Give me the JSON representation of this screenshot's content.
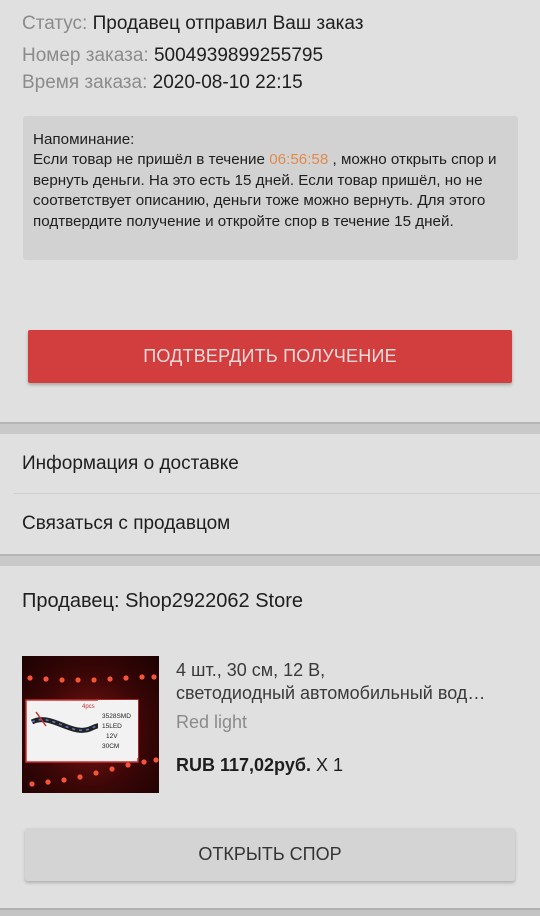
{
  "order": {
    "status_label": "Статус:",
    "status_value": "Продавец отправил Ваш заказ",
    "number_label": "Номер заказа:",
    "number_value": "5004939899255795",
    "time_label": "Время заказа:",
    "time_value": "2020-08-10 22:15"
  },
  "reminder": {
    "heading": "Напоминание:",
    "text_before_timer": "Если товар не пришёл в течение ",
    "timer": "06:56:58",
    "text_after_timer": " , можно открыть спор и вернуть деньги. На это есть 15 дней.    Если товар пришёл, но не соответствует описанию, деньги тоже можно вернуть. Для этого подтвердите получение и откройте спор в течение 15 дней."
  },
  "actions": {
    "confirm_label": "ПОДТВЕРДИТЬ ПОЛУЧЕНИЕ",
    "dispute_label": "ОТКРЫТЬ СПОР"
  },
  "menu": {
    "delivery_info": "Информация о доставке",
    "contact_seller": "Связаться с продавцом"
  },
  "seller": {
    "title": "Продавец: Shop2922062 Store"
  },
  "product": {
    "title_line1": "4 шт., 30 см, 12 В,",
    "title_line2": "светодиодный автомобильный вод…",
    "variant": "Red light",
    "price": "RUB 117,02руб.",
    "quantity": "X 1",
    "image_labels": {
      "pack": "4pcs",
      "chip": "3528SMD",
      "leds": "15LED",
      "volt": "12V",
      "length": "30CM"
    }
  },
  "colors": {
    "accent": "#d23d3e",
    "timer": "#e08a4d",
    "background": "#e0e0e0"
  }
}
